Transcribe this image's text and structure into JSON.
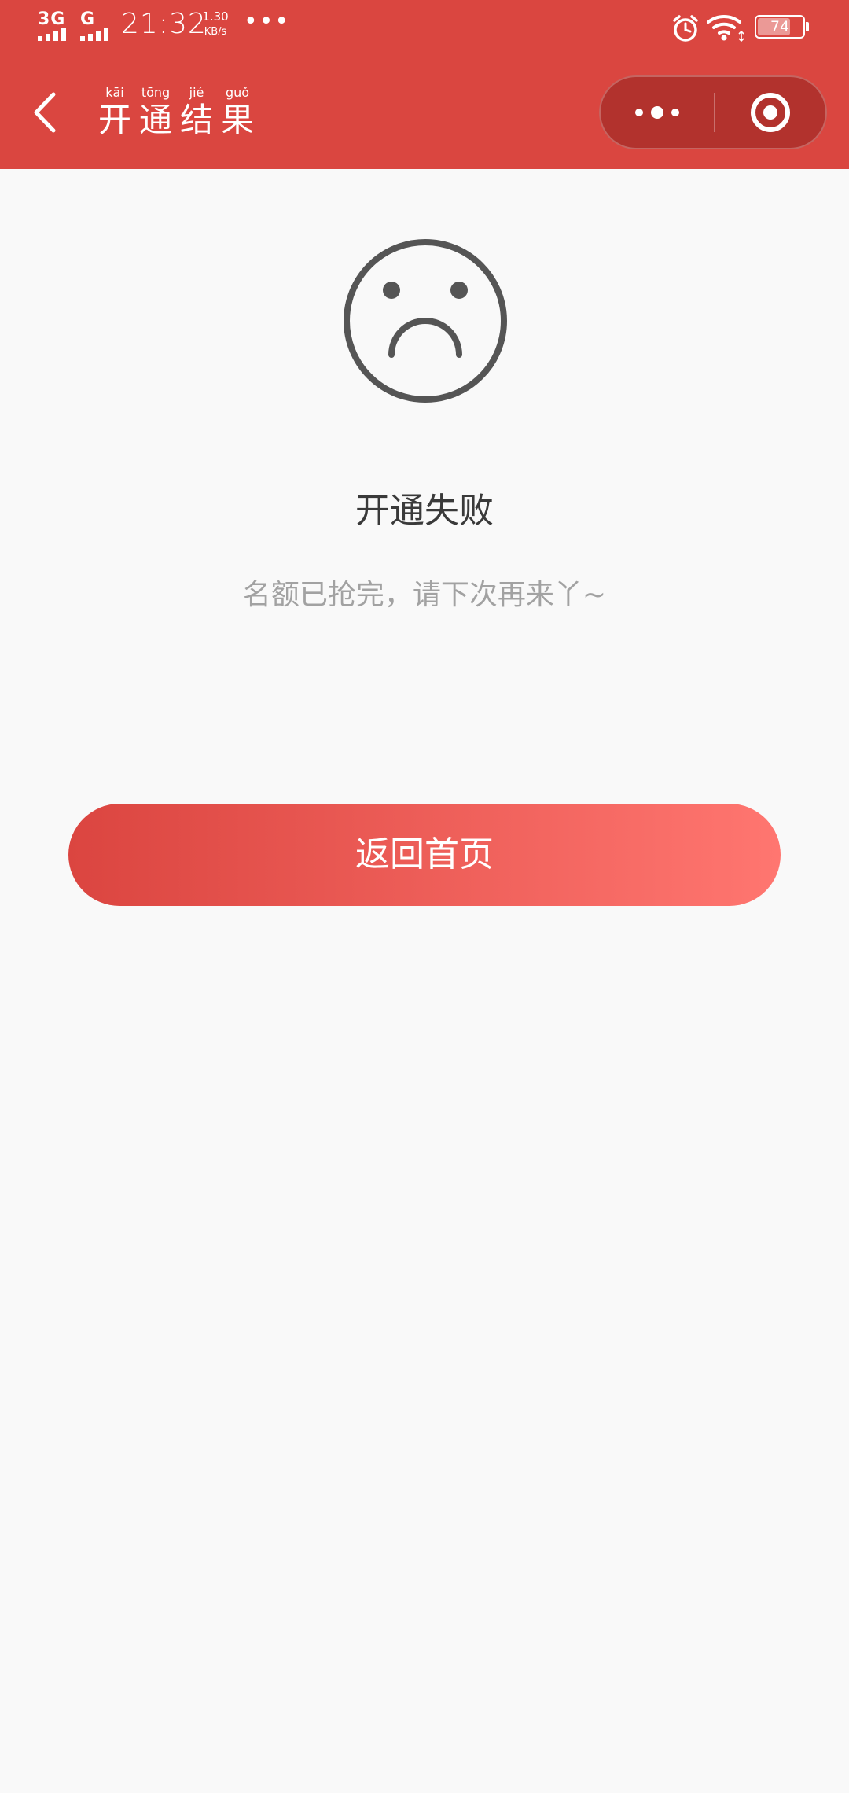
{
  "status_bar": {
    "network_1": "3G",
    "network_2": "G",
    "time": "21:32",
    "speed_value": "1.30",
    "speed_unit": "KB/s",
    "more": "•••",
    "battery": "74",
    "battery_level": 0.74
  },
  "nav": {
    "back_icon": "chevron-left-icon",
    "title_chars": [
      {
        "pinyin": "kāi",
        "hanzi": "开"
      },
      {
        "pinyin": "tōng",
        "hanzi": "通"
      },
      {
        "pinyin": "jié",
        "hanzi": "结"
      },
      {
        "pinyin": "guǒ",
        "hanzi": "果"
      }
    ],
    "capsule_menu_icon": "more-dots-icon",
    "capsule_close_icon": "target-circle-icon"
  },
  "result": {
    "icon": "sad-face-icon",
    "title": "开通失败",
    "description": "名额已抢完，请下次再来丫~"
  },
  "actions": {
    "home_button_label": "返回首页"
  },
  "colors": {
    "header": "#da4640",
    "button_start": "#db4540",
    "button_end": "#ff7670",
    "capsule": "#b2322d",
    "background": "#f9f9f9",
    "title_text": "#3a3a3a",
    "desc_text": "#a2a2a2",
    "icon_stroke": "#555555"
  }
}
